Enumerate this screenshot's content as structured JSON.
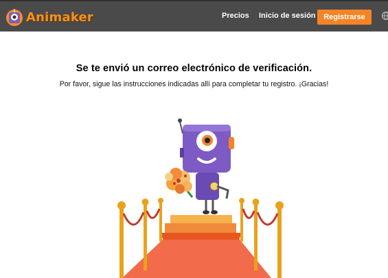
{
  "header": {
    "brand": "Animaker",
    "nav_links": [
      "Precios",
      "Inicio de sesión"
    ],
    "signup_label": "Registrarse",
    "globe_icon": "globe-icon"
  },
  "main": {
    "title": "Se te envió un correo electrónico de verificación.",
    "subtitle": "Por favor, sigue las instrucciones indicadas allí para completar tu registro. ¡Gracias!"
  },
  "colors": {
    "nav_bg": "#4a4a4a",
    "accent": "#f58426",
    "robot": "#7e5bc4",
    "carpet": "#f26b4a",
    "gold": "#e8a21c"
  }
}
